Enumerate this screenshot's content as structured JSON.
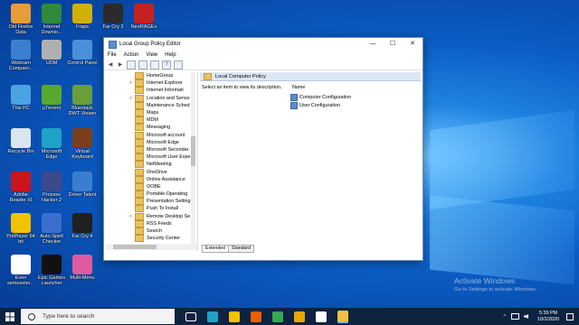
{
  "desktop": {
    "icons": [
      {
        "label": "Old Firefox Data",
        "icon": "firefox-folder-icon",
        "color": "#e89c3c"
      },
      {
        "label": "Internet Downlo...",
        "icon": "internet-download-icon",
        "color": "#2f8a3a"
      },
      {
        "label": "Fraps",
        "icon": "fraps-icon",
        "color": "#d0b000"
      },
      {
        "label": "Far Cry 3",
        "icon": "farcry3-icon",
        "color": "#2b2b2b"
      },
      {
        "label": "NeoRAGEx",
        "icon": "neoragex-icon",
        "color": "#c82020"
      },
      {
        "label": "Webcam Compani...",
        "icon": "webcam-icon",
        "color": "#3a7fd0"
      },
      {
        "label": "UDM",
        "icon": "udm-icon",
        "color": "#b0b0b0"
      },
      {
        "label": "Control Panel",
        "icon": "control-panel-icon",
        "color": "#4a90d9"
      },
      {
        "label": "This PC",
        "icon": "this-pc-icon",
        "color": "#4aa3e0"
      },
      {
        "label": "µTorrent",
        "icon": "utorrent-icon",
        "color": "#59a82e"
      },
      {
        "label": "Bluestack DWT Viewer",
        "icon": "bluestacks-icon",
        "color": "#6a9e3a"
      },
      {
        "label": "Recycle Bin",
        "icon": "recycle-bin-icon",
        "color": "#d8e6f0"
      },
      {
        "label": "Microsoft Edge",
        "icon": "edge-icon",
        "color": "#1fa3c7"
      },
      {
        "label": "Virtual Keyboard",
        "icon": "keyboard-icon",
        "color": "#7a3f1c"
      },
      {
        "label": "Adobe Reader XI",
        "icon": "adobe-reader-icon",
        "color": "#c8161d"
      },
      {
        "label": "Process Hacker 2",
        "icon": "process-hacker-icon",
        "color": "#3c4a8c"
      },
      {
        "label": "Driver Talent",
        "icon": "driver-talent-icon",
        "color": "#3b7ed0"
      },
      {
        "label": "PotPlayer 64 bit",
        "icon": "potplayer-icon",
        "color": "#f2c200"
      },
      {
        "label": "Auto-Spell Checker",
        "icon": "spell-checker-icon",
        "color": "#3a6fd0"
      },
      {
        "label": "Far Cry 4",
        "icon": "farcry4-icon",
        "color": "#202020"
      },
      {
        "label": "Even semeseter...",
        "icon": "document-icon",
        "color": "#ffffff"
      },
      {
        "label": "Epic Games Launcher",
        "icon": "epic-games-icon",
        "color": "#111111"
      },
      {
        "label": "Multi-Menu",
        "icon": "multi-menu-icon",
        "color": "#e05aa0"
      }
    ]
  },
  "window": {
    "title": "Local Group Policy Editor",
    "controls": {
      "minimize": "—",
      "maximize": "☐",
      "close": "✕"
    },
    "menu": [
      "File",
      "Action",
      "View",
      "Help"
    ],
    "toolbar": [
      {
        "icon": "back-arrow-icon",
        "glyph": "◀"
      },
      {
        "icon": "forward-arrow-icon",
        "glyph": "▶"
      },
      {
        "icon": "show-hide-tree-icon",
        "glyph": ""
      },
      {
        "icon": "grid-view-icon",
        "glyph": ""
      },
      {
        "icon": "export-icon",
        "glyph": ""
      },
      {
        "icon": "help-icon",
        "glyph": "?"
      },
      {
        "icon": "properties-icon",
        "glyph": ""
      }
    ],
    "tree": [
      {
        "label": "HomeGroup",
        "expandable": false
      },
      {
        "label": "Internet Explorer",
        "expandable": true
      },
      {
        "label": "Internet Informati",
        "expandable": false
      },
      {
        "label": "Location and Senso",
        "expandable": true
      },
      {
        "label": "Maintenance Sched",
        "expandable": false
      },
      {
        "label": "Maps",
        "expandable": false
      },
      {
        "label": "MDM",
        "expandable": false
      },
      {
        "label": "Messaging",
        "expandable": false
      },
      {
        "label": "Microsoft account",
        "expandable": false
      },
      {
        "label": "Microsoft Edge",
        "expandable": false
      },
      {
        "label": "Microsoft Secondar",
        "expandable": false
      },
      {
        "label": "Microsoft User Expe",
        "expandable": false
      },
      {
        "label": "NetMeeting",
        "expandable": false
      },
      {
        "label": "OneDrive",
        "expandable": false
      },
      {
        "label": "Online Assistance",
        "expandable": false
      },
      {
        "label": "OOBE",
        "expandable": false
      },
      {
        "label": "Portable Operating",
        "expandable": false
      },
      {
        "label": "Presentation Setting",
        "expandable": false
      },
      {
        "label": "Push To Install",
        "expandable": false
      },
      {
        "label": "Remote Desktop Se",
        "expandable": true
      },
      {
        "label": "RSS Feeds",
        "expandable": false
      },
      {
        "label": "Search",
        "expandable": false
      },
      {
        "label": "Security Center",
        "expandable": false
      }
    ],
    "right_pane": {
      "header": "Local Computer Policy",
      "description": "Select an item to view its description.",
      "name_column": "Name",
      "items": [
        "Computer Configuration",
        "User Configuration"
      ]
    },
    "tabs": [
      "Extended",
      "Standard"
    ]
  },
  "taskbar": {
    "search_placeholder": "Type here to search",
    "pinned": [
      {
        "icon": "task-view-icon",
        "color": "#ffffff"
      },
      {
        "icon": "edge-icon",
        "color": "#1fa3c7"
      },
      {
        "icon": "file-explorer-icon",
        "color": "#f2c200"
      },
      {
        "icon": "firefox-icon",
        "color": "#e66000"
      },
      {
        "icon": "chrome-icon",
        "color": "#34a853"
      },
      {
        "icon": "winamp-icon",
        "color": "#e8a800"
      },
      {
        "icon": "clock-app-icon",
        "color": "#ffffff"
      },
      {
        "icon": "group-policy-icon",
        "color": "#f0c040"
      }
    ],
    "tray": {
      "expand": "^",
      "time": "5:39 PM",
      "date": "10/2/2020"
    }
  },
  "watermark": {
    "line1": "Activate Windows",
    "line2": "Go to Settings to activate Windows."
  }
}
